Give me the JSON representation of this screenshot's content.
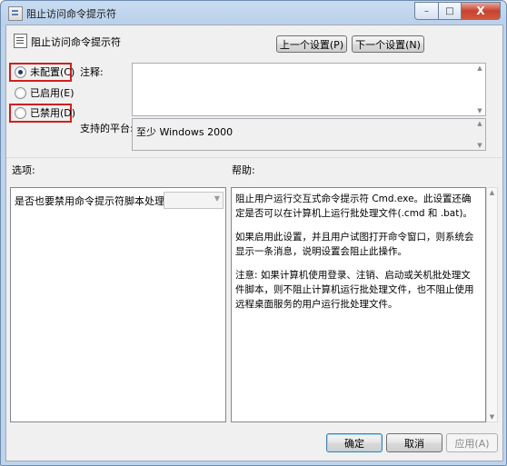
{
  "window": {
    "title": "阻止访问命令提示符",
    "caption": {
      "minimize": "–",
      "maximize": "□",
      "close": "X"
    }
  },
  "header": {
    "policy_title": "阻止访问命令提示符",
    "prev_button": "上一个设置(P)",
    "next_button": "下一个设置(N)"
  },
  "state": {
    "options": [
      {
        "label": "未配置(C)",
        "checked": true,
        "highlighted": true
      },
      {
        "label": "已启用(E)",
        "checked": false,
        "highlighted": false
      },
      {
        "label": "已禁用(D)",
        "checked": false,
        "highlighted": true
      }
    ]
  },
  "comment": {
    "label": "注释:",
    "value": ""
  },
  "platform": {
    "label": "支持的平台:",
    "value": "至少 Windows 2000"
  },
  "options_section": {
    "label": "选项:",
    "question": "是否也要禁用命令提示符脚本处理？",
    "dropdown_value": ""
  },
  "help_section": {
    "label": "帮助:",
    "paragraphs": [
      "阻止用户运行交互式命令提示符 Cmd.exe。此设置还确定是否可以在计算机上运行批处理文件(.cmd 和 .bat)。",
      "如果启用此设置，并且用户试图打开命令窗口，则系统会显示一条消息，说明设置会阻止此操作。",
      "注意: 如果计算机使用登录、注销、启动或关机批处理文件脚本，则不阻止计算机运行批处理文件，也不阻止使用远程桌面服务的用户运行批处理文件。"
    ]
  },
  "footer": {
    "ok": "确定",
    "cancel": "取消",
    "apply": "应用(A)"
  },
  "colors": {
    "highlight": "#d21f1f",
    "title_bar": "#bad1ec",
    "client_bg": "#f0f0f0"
  }
}
